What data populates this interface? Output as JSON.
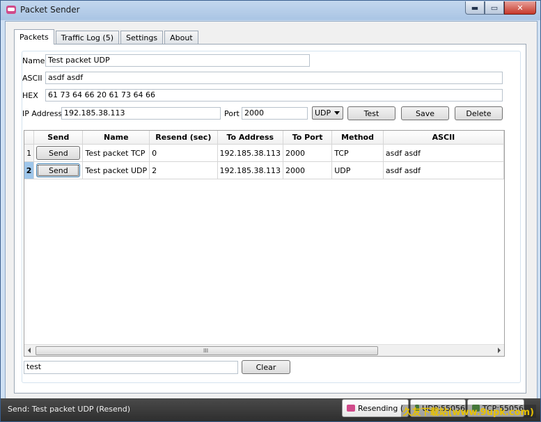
{
  "window": {
    "title": "Packet Sender",
    "min_symbol": "▬",
    "max_symbol": "▭",
    "close_symbol": "✕"
  },
  "tabs": [
    {
      "label": "Packets",
      "active": true
    },
    {
      "label": "Traffic Log (5)",
      "active": false
    },
    {
      "label": "Settings",
      "active": false
    },
    {
      "label": "About",
      "active": false
    }
  ],
  "form": {
    "name_label": "Name",
    "name_value": "Test packet UDP",
    "ascii_label": "ASCII",
    "ascii_value": "asdf asdf",
    "hex_label": "HEX",
    "hex_value": "61 73 64 66 20 61 73 64 66",
    "ip_label": "IP Address",
    "ip_value": "192.185.38.113",
    "port_label": "Port",
    "port_value": "2000",
    "method_value": "UDP",
    "test_button": "Test",
    "save_button": "Save",
    "delete_button": "Delete"
  },
  "table": {
    "columns": [
      "Send",
      "Name",
      "Resend (sec)",
      "To Address",
      "To Port",
      "Method",
      "ASCII"
    ],
    "rows": [
      {
        "num": "1",
        "send": "Send",
        "name": "Test packet TCP",
        "resend": "0",
        "address": "192.185.38.113",
        "port": "2000",
        "method": "TCP",
        "ascii": "asdf asdf"
      },
      {
        "num": "2",
        "send": "Send",
        "name": "Test packet UDP",
        "resend": "2",
        "address": "192.185.38.113",
        "port": "2000",
        "method": "UDP",
        "ascii": "asdf asdf"
      }
    ],
    "scroll_grip": "III"
  },
  "filter": {
    "value": "test",
    "clear_button": "Clear"
  },
  "status": {
    "text": "Send: Test packet UDP (Resend)",
    "resending_label": "Resending (",
    "udp_label": "UDP:55056",
    "tcp_label": "TCP:55056"
  },
  "watermark": "久友下载站(www.9upk.com)",
  "colors": {
    "accent": "#d04a8a",
    "selected_row": "#9ec6ea",
    "statusbar": "#3a3a3a"
  }
}
